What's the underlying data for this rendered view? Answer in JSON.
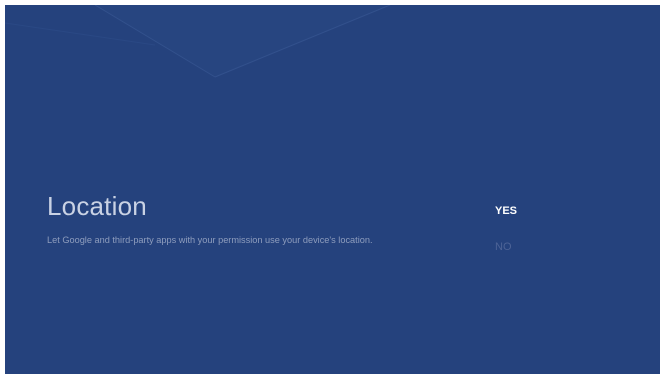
{
  "setting": {
    "title": "Location",
    "description": "Let Google and third-party apps with your permission use your device's location."
  },
  "options": [
    {
      "label": "YES",
      "selected": true
    },
    {
      "label": "NO",
      "selected": false
    }
  ],
  "colors": {
    "background": "#25427d",
    "title_text": "#c9d2e4",
    "selected_option": "#ffffff",
    "unselected_option": "#4d6396"
  }
}
